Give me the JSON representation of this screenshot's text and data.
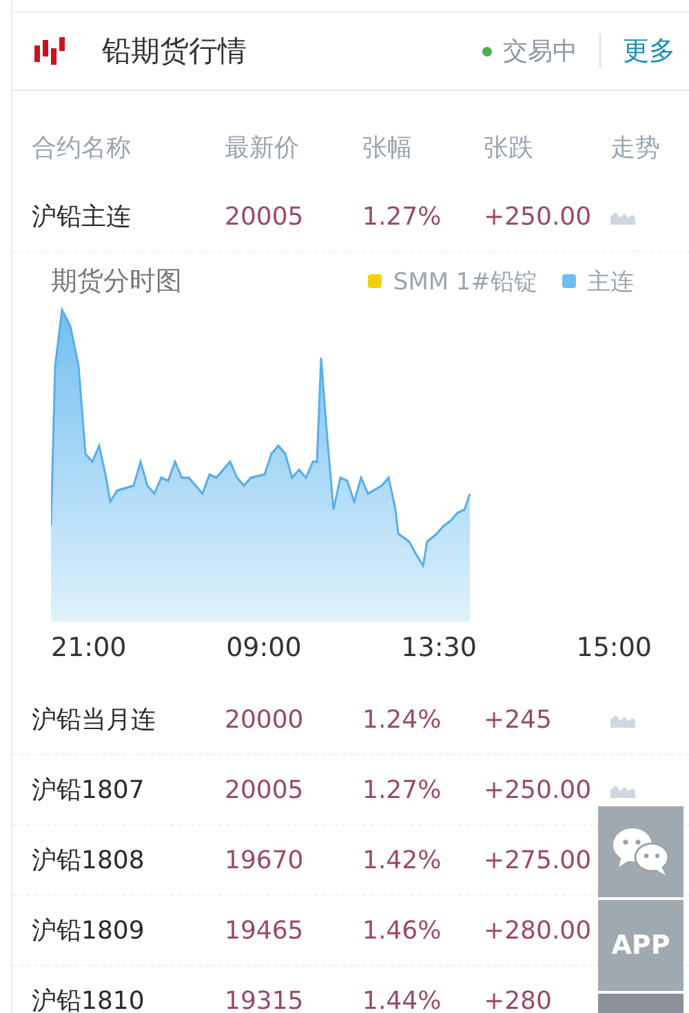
{
  "header": {
    "title": "铅期货行情",
    "status": "交易中",
    "more_link": "更多"
  },
  "table": {
    "columns": [
      "合约名称",
      "最新价",
      "张幅",
      "张跌",
      "走势"
    ],
    "rows_top": [
      {
        "name": "沪铅主连",
        "price": "20005",
        "pct": "1.27%",
        "change": "+250.00"
      }
    ],
    "rows_bottom": [
      {
        "name": "沪铅当月连",
        "price": "20000",
        "pct": "1.24%",
        "change": "+245"
      },
      {
        "name": "沪铅1807",
        "price": "20005",
        "pct": "1.27%",
        "change": "+250.00"
      },
      {
        "name": "沪铅1808",
        "price": "19670",
        "pct": "1.42%",
        "change": "+275.00"
      },
      {
        "name": "沪铅1809",
        "price": "19465",
        "pct": "1.46%",
        "change": "+280.00"
      },
      {
        "name": "沪铅1810",
        "price": "19315",
        "pct": "1.44%",
        "change": "+280"
      }
    ]
  },
  "chart": {
    "title": "期货分时图",
    "legend": [
      {
        "label": "SMM 1#铅锭",
        "color": "#f5d000"
      },
      {
        "label": "主连",
        "color": "#6bbcf0"
      }
    ],
    "time_labels": [
      "21:00",
      "09:00",
      "13:30",
      "15:00"
    ]
  },
  "floating_buttons": [
    {
      "kind": "chat"
    },
    {
      "kind": "text",
      "label": "APP"
    },
    {
      "kind": "blank"
    }
  ]
}
